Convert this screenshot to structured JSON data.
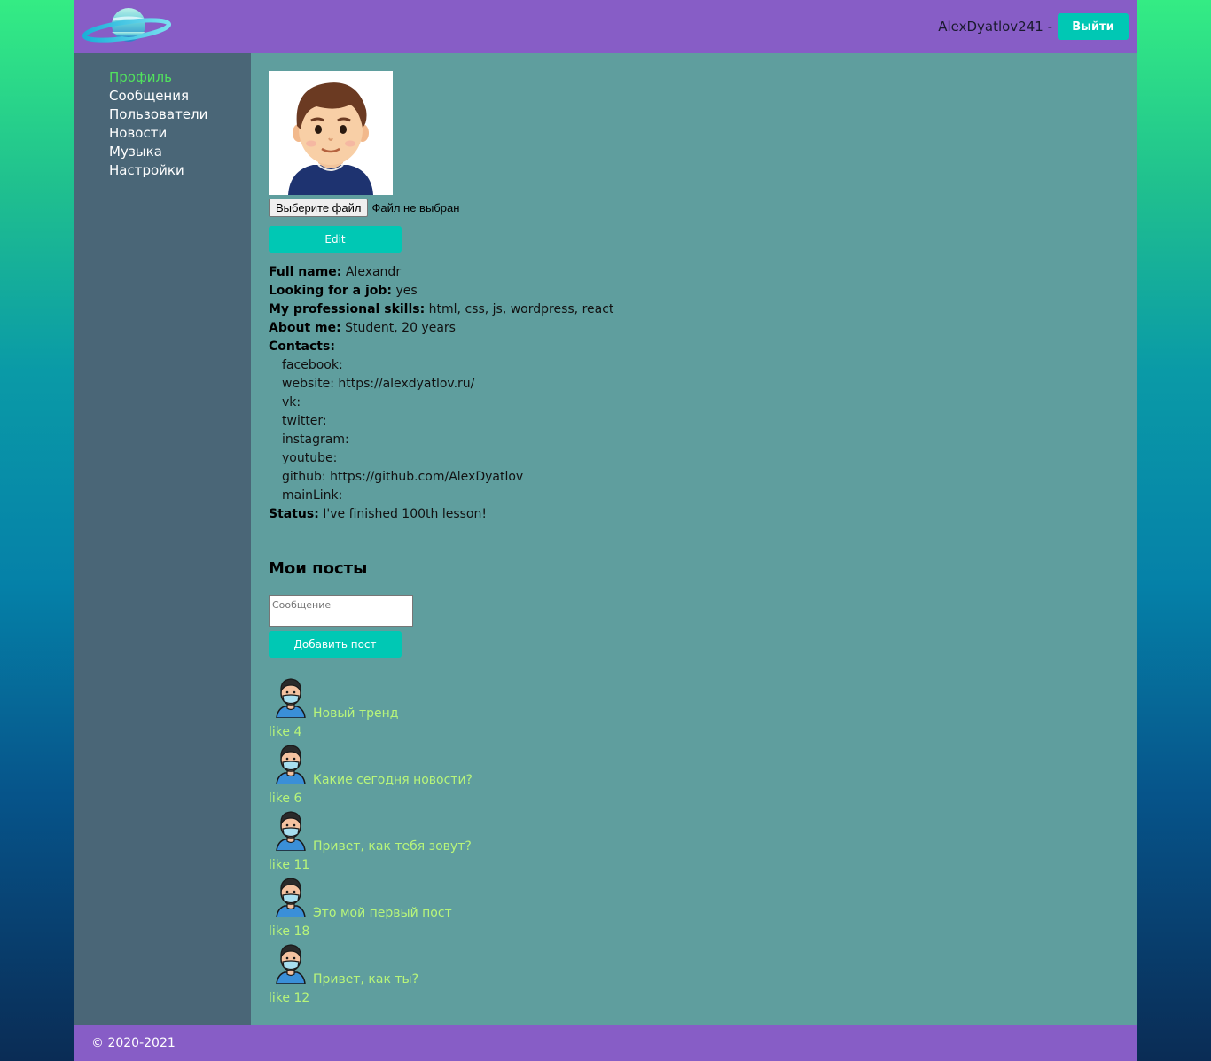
{
  "header": {
    "login_name": "AlexDyatlov241 -",
    "logout_label": "Выйти"
  },
  "sidebar": {
    "items": [
      {
        "label": "Профиль"
      },
      {
        "label": "Сообщения"
      },
      {
        "label": "Пользователи"
      },
      {
        "label": "Новости"
      },
      {
        "label": "Музыка"
      },
      {
        "label": "Настройки"
      }
    ]
  },
  "profile": {
    "file_button": "Выберите файл",
    "file_status": "Файл не выбран",
    "edit_label": "Edit",
    "full_name_label": "Full name:",
    "full_name": "Alexandr",
    "job_label": "Looking for a job:",
    "job": "yes",
    "skills_label": "My professional skills:",
    "skills": "html, css, js, wordpress, react",
    "about_label": "About me:",
    "about": "Student, 20 years",
    "contacts_label": "Contacts:",
    "contacts": [
      "facebook:",
      "website: https://alexdyatlov.ru/",
      "vk:",
      "twitter:",
      "instagram:",
      "youtube:",
      "github: https://github.com/AlexDyatlov",
      "mainLink:"
    ],
    "status_label": "Status:",
    "status": "I've finished 100th lesson!"
  },
  "posts_section": {
    "title": "Мои посты",
    "placeholder": "Сообщение",
    "add_label": "Добавить пост",
    "posts": [
      {
        "text": "Новый тренд",
        "likes": "like 4"
      },
      {
        "text": "Какие сегодня новости?",
        "likes": "like 6"
      },
      {
        "text": "Привет, как тебя зовут?",
        "likes": "like 11"
      },
      {
        "text": "Это мой первый пост",
        "likes": "like 18"
      },
      {
        "text": "Привет, как ты?",
        "likes": "like 12"
      }
    ]
  },
  "footer": {
    "text": "© 2020-2021"
  },
  "colors": {
    "header": "#875dc6",
    "sidebar": "#4a6677",
    "content": "#5f9e9e",
    "accent": "#00c8b4",
    "active_nav": "#51e35d",
    "post_text": "#b8f57a"
  }
}
